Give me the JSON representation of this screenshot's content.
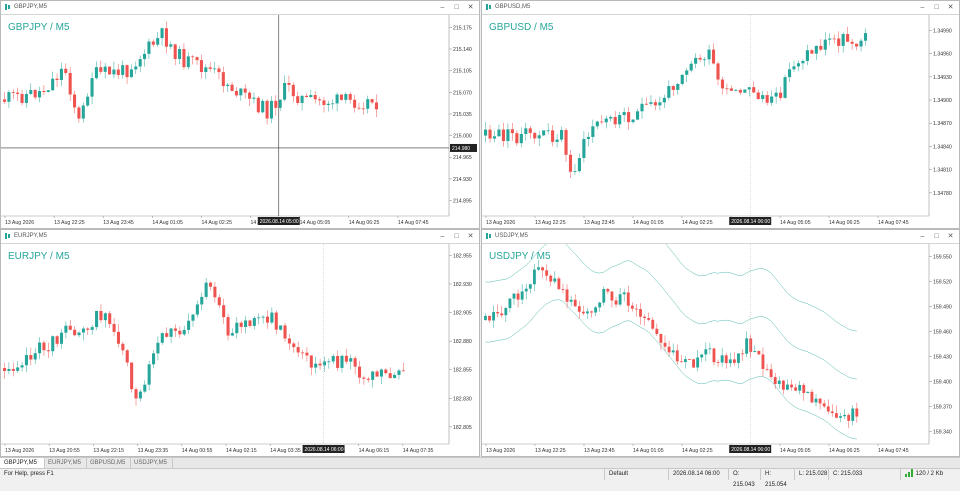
{
  "windows": [
    {
      "id": "w1",
      "title": "GBPJPY,M5",
      "symbol": "GBPJPY / M5",
      "prices": [
        "215.175",
        "215.140",
        "215.105",
        "215.070",
        "215.035",
        "215.000",
        "214.965",
        "214.930",
        "214.895"
      ],
      "price_range": [
        214.87,
        215.195
      ],
      "times": [
        "13 Aug 2026",
        "13 Aug 22:25",
        "13 Aug 23:45",
        "14 Aug 01:05",
        "14 Aug 02:25",
        "14 Aug 03:45",
        "14 Aug 05:05",
        "14 Aug 06:25",
        "14 Aug 07:45"
      ],
      "crosshair_price": "214.980",
      "crosshair_time": "2026.08.14 05:00"
    },
    {
      "id": "w2",
      "title": "GBPUSD,M5",
      "symbol": "GBPUSD / M5",
      "prices": [
        "1.34990",
        "1.34960",
        "1.34930",
        "1.34900",
        "1.34870",
        "1.34840",
        "1.34810",
        "1.34780"
      ],
      "price_range": [
        1.3475,
        1.3501
      ],
      "times": [
        "13 Aug 2026",
        "13 Aug 22:25",
        "13 Aug 23:45",
        "14 Aug 01:05",
        "14 Aug 02:25",
        "14 Aug 03:45",
        "14 Aug 05:05",
        "14 Aug 06:25",
        "14 Aug 07:45"
      ],
      "crosshair_time": "2026.08.14 06:00"
    },
    {
      "id": "w3",
      "title": "EURJPY,M5",
      "symbol": "EURJPY / M5",
      "prices": [
        "182.955",
        "182.930",
        "182.905",
        "182.880",
        "182.855",
        "182.830",
        "182.805"
      ],
      "price_range": [
        182.79,
        182.965
      ],
      "times": [
        "13 Aug 2026",
        "13 Aug 20:55",
        "13 Aug 22:15",
        "13 Aug 23:35",
        "14 Aug 00:55",
        "14 Aug 02:15",
        "14 Aug 03:35",
        "14 Aug 04:55",
        "14 Aug 06:15",
        "14 Aug 07:35"
      ],
      "crosshair_time": "2026.08.14 06:00"
    },
    {
      "id": "w4",
      "title": "USDJPY,M5",
      "symbol": "USDJPY / M5",
      "prices": [
        "159.550",
        "159.520",
        "159.490",
        "159.460",
        "159.430",
        "159.400",
        "159.370",
        "159.340"
      ],
      "price_range": [
        159.325,
        159.565
      ],
      "times": [
        "13 Aug 2026",
        "13 Aug 22:25",
        "13 Aug 23:45",
        "14 Aug 01:05",
        "14 Aug 02:25",
        "14 Aug 03:45",
        "14 Aug 05:05",
        "14 Aug 06:25",
        "14 Aug 07:45"
      ],
      "crosshair_time": "2026.08.14 06:00"
    }
  ],
  "tabs": [
    "GBPJPY,M5",
    "EURJPY,M5",
    "GBPUSD,M5",
    "USDJPY,M5"
  ],
  "status": {
    "help": "For Help, press F1",
    "profile": "Default",
    "datetime": "2026.08.14 06:00",
    "open": "O: 215.043",
    "high": "H: 215.054",
    "low": "L: 215.028",
    "close": "C: 215.033",
    "traffic": "120 / 2 Kb"
  },
  "colors": {
    "bull": "#26a69a",
    "bear": "#ef5350",
    "band": "#26a69a",
    "crosshair": "#333333"
  },
  "icons": {
    "chart": "chart-icon",
    "minimize": "minimize-icon",
    "maximize": "maximize-icon",
    "close": "close-icon",
    "signal": "signal-bars-icon"
  }
}
